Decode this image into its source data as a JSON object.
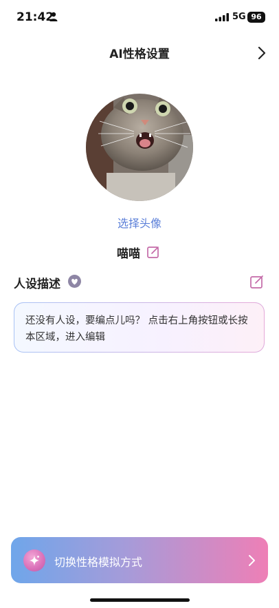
{
  "status_bar": {
    "time": "21:42",
    "network": "5G",
    "battery": "96"
  },
  "header": {
    "title": "AI性格设置"
  },
  "avatar": {
    "choose_label": "选择头像"
  },
  "character": {
    "name": "喵喵"
  },
  "persona": {
    "title": "人设描述",
    "placeholder": "还没有人设，要编点儿吗？ 点击右上角按钮或长按本区域，进入编辑"
  },
  "bottom": {
    "switch_label": "切换性格模拟方式"
  },
  "colors": {
    "accent_blue": "#5b7fd8",
    "edit_icon_pink": "#c46aa8",
    "gradient_start": "#6fa6ea",
    "gradient_end": "#ee7fb6"
  },
  "icons": [
    "person-icon",
    "signal-icon",
    "chevron-right-icon",
    "edit-icon",
    "heart-icon",
    "sparkle-icon"
  ]
}
